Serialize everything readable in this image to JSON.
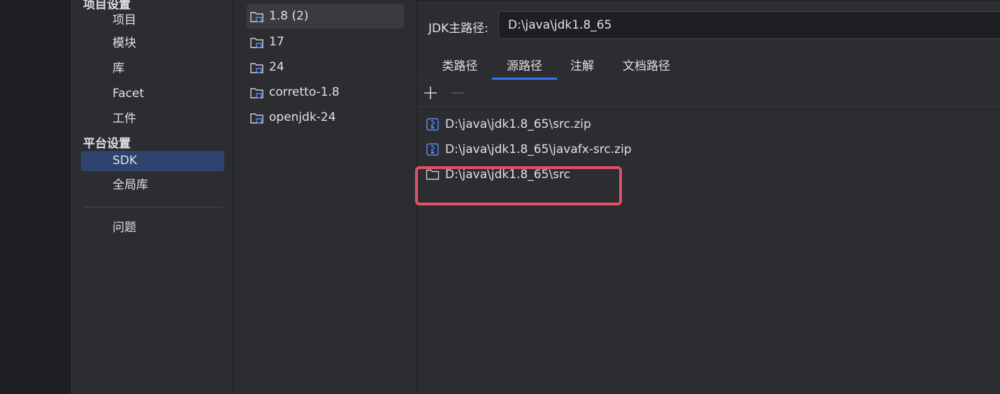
{
  "nav": {
    "header_project": "项目设置",
    "header_platform": "平台设置",
    "items": [
      {
        "label": "项目"
      },
      {
        "label": "模块"
      },
      {
        "label": "库"
      },
      {
        "label": "Facet"
      },
      {
        "label": "工件"
      },
      {
        "label": "SDK"
      },
      {
        "label": "全局库"
      },
      {
        "label": "问题"
      }
    ]
  },
  "sdks": [
    {
      "label": "1.8 (2)"
    },
    {
      "label": "17"
    },
    {
      "label": "24"
    },
    {
      "label": "corretto-1.8"
    },
    {
      "label": "openjdk-24"
    }
  ],
  "detail": {
    "jdk_label": "JDK主路径:",
    "jdk_path": "D:\\java\\jdk1.8_65",
    "tabs": [
      {
        "label": "类路径"
      },
      {
        "label": "源路径"
      },
      {
        "label": "注解"
      },
      {
        "label": "文档路径"
      }
    ],
    "active_tab": "源路径",
    "toolbar": {
      "add_icon": "plus-icon",
      "remove_icon": "minus-icon"
    },
    "paths": [
      {
        "label": "D:\\java\\jdk1.8_65\\src.zip",
        "icon": "archive-icon"
      },
      {
        "label": "D:\\java\\jdk1.8_65\\javafx-src.zip",
        "icon": "archive-icon"
      },
      {
        "label": "D:\\java\\jdk1.8_65\\src",
        "icon": "folder-icon"
      }
    ]
  },
  "colors": {
    "accent": "#3574f0",
    "selection": "#2e436e",
    "highlight": "#e2506a"
  }
}
